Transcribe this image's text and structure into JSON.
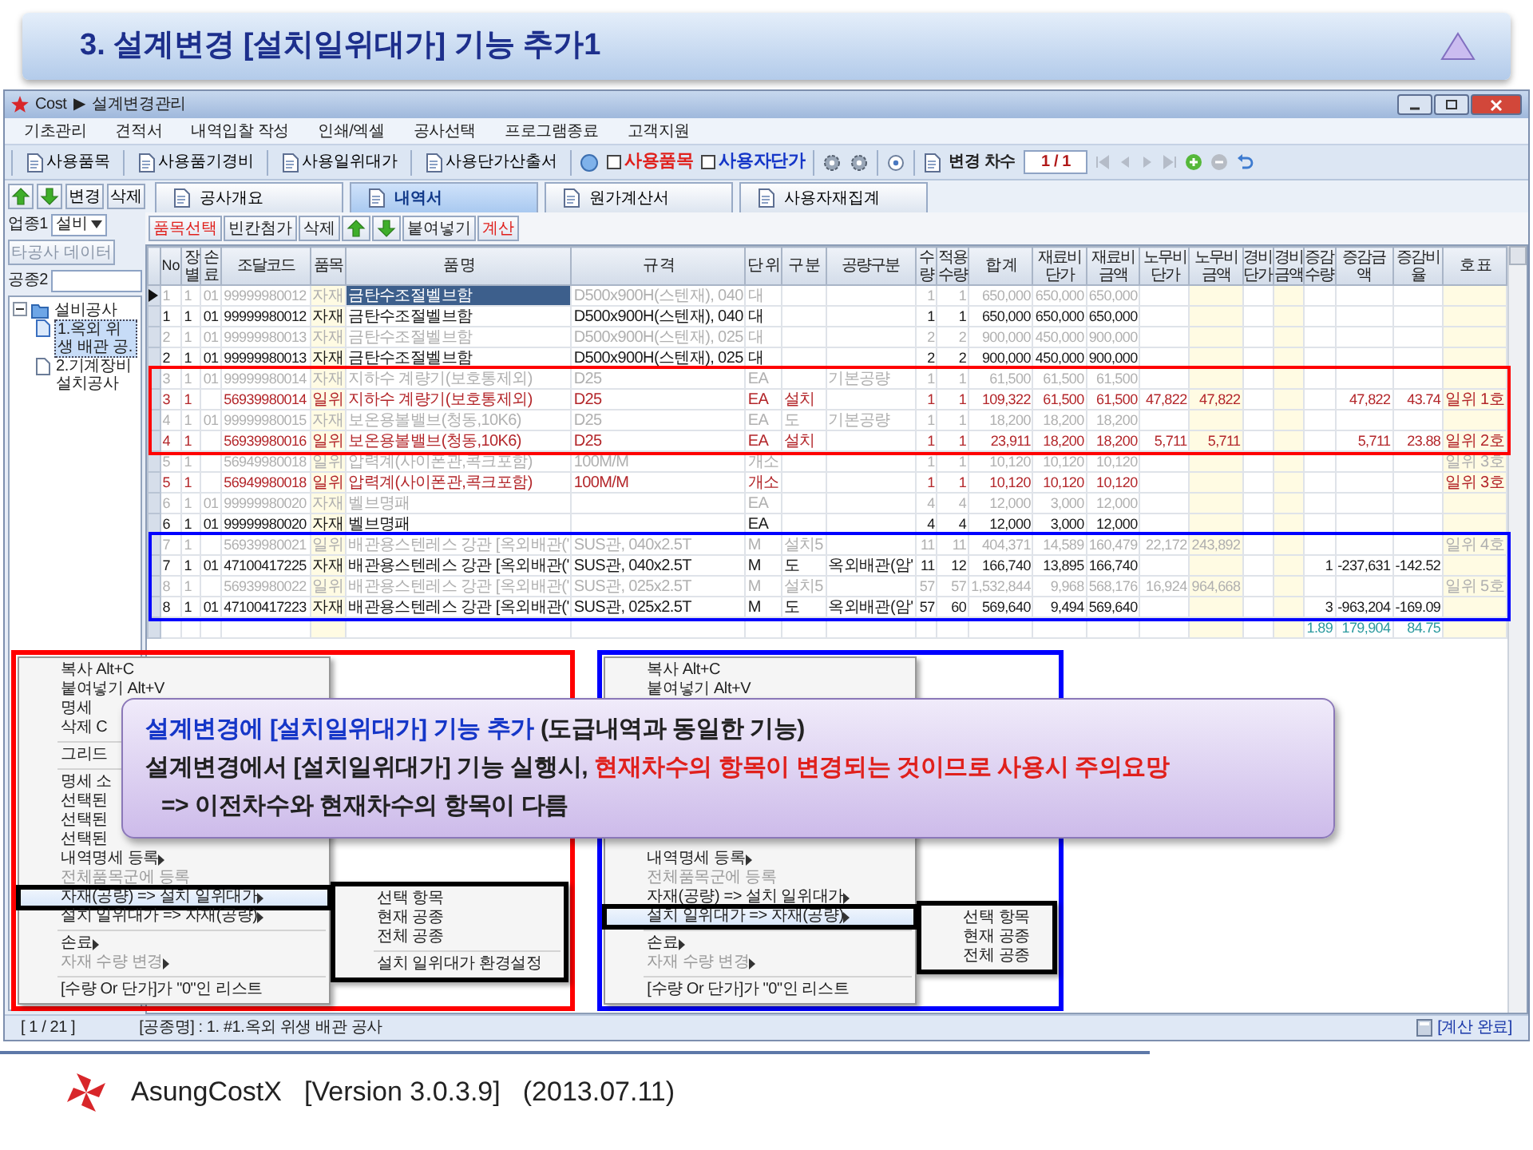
{
  "slide_title": {
    "text": "3. 설계변경 [설치일위대가] 기능 추가1"
  },
  "app": {
    "title_bar": {
      "app_name": "Cost",
      "separator": "▶",
      "screen": "설계변경관리"
    },
    "menu_bar": [
      "기초관리",
      "견적서",
      "내역입찰 작성",
      "인쇄/엑셀",
      "공사선택",
      "프로그램종료",
      "고객지원"
    ],
    "toolbar": {
      "buttons": [
        "사용품목",
        "사용품기경비",
        "사용일위대가",
        "사용단가산출서"
      ],
      "checks": [
        {
          "label": "사용품목",
          "checked": false,
          "color": "#e0201c"
        },
        {
          "label": "사용자단가",
          "checked": false,
          "color": "#1536c8"
        }
      ],
      "revision_label": "변경 차수",
      "revision_value": "1 / 1"
    },
    "left_panel": {
      "buttons": [
        {
          "kind": "up"
        },
        {
          "kind": "down"
        },
        {
          "kind": "text",
          "label": "변경"
        },
        {
          "kind": "text",
          "label": "삭제"
        }
      ],
      "field1_label": "업종1",
      "field1_value": "설비",
      "other_data_button": "타공사 데이터",
      "field2_label": "공종2",
      "tree": [
        {
          "label": "설비공사",
          "expanded": true,
          "selected": false,
          "children": [
            {
              "label": "1.옥외 위생 배관 공.",
              "selected": true
            },
            {
              "label": "2.기계장비 설치공사",
              "selected": false
            }
          ]
        }
      ]
    },
    "tabs": [
      {
        "label": "공사개요",
        "selected": false
      },
      {
        "label": "내역서",
        "selected": true
      },
      {
        "label": "원가계산서",
        "selected": false
      },
      {
        "label": "사용자재집계",
        "selected": false
      }
    ],
    "grid_buttons": [
      {
        "kind": "text",
        "label": "품목선택",
        "color": "#e0201c"
      },
      {
        "kind": "text",
        "label": "빈칸첨가",
        "color": "#222222"
      },
      {
        "kind": "text",
        "label": "삭제",
        "color": "#222222"
      },
      {
        "kind": "up"
      },
      {
        "kind": "down"
      },
      {
        "kind": "text",
        "label": "붙여넣기",
        "color": "#222222"
      },
      {
        "kind": "text",
        "label": "계산",
        "color": "#e0201c"
      }
    ],
    "grid": {
      "columns": [
        "No",
        "장별",
        "손료",
        "조달코드",
        "품목",
        "품 명",
        "규 격",
        "단 위",
        "구 분",
        "공량구분",
        "수 량",
        "적용수량",
        "합 계",
        "재료비단가",
        "재료비금액",
        "노무비단가",
        "노무비금액",
        "경비단가",
        "경비금액",
        "증감수량",
        "증감금액",
        "증감비율",
        "호 표"
      ],
      "rows": [
        {
          "kind": "previous",
          "selected": true,
          "cells": [
            "1",
            "1",
            "01",
            "99999980012",
            "자재",
            "금탄수조절벨브함",
            "D500x900H(스텐재), 040",
            "대",
            null,
            null,
            "1",
            "1",
            "650,000",
            "650,000",
            "650,000",
            null,
            null,
            null,
            null,
            null,
            null,
            null,
            null
          ]
        },
        {
          "kind": "current",
          "selected": false,
          "cells": [
            "1",
            "1",
            "01",
            "99999980012",
            "자재",
            "금탄수조절벨브함",
            "D500x900H(스텐재), 040",
            "대",
            null,
            null,
            "1",
            "1",
            "650,000",
            "650,000",
            "650,000",
            null,
            null,
            null,
            null,
            null,
            null,
            null,
            null
          ]
        },
        {
          "kind": "previous",
          "selected": false,
          "cells": [
            "2",
            "1",
            "01",
            "99999980013",
            "자재",
            "금탄수조절벨브함",
            "D500x900H(스텐재), 025",
            "대",
            null,
            null,
            "2",
            "2",
            "900,000",
            "450,000",
            "900,000",
            null,
            null,
            null,
            null,
            null,
            null,
            null,
            null
          ]
        },
        {
          "kind": "current",
          "selected": false,
          "cells": [
            "2",
            "1",
            "01",
            "99999980013",
            "자재",
            "금탄수조절벨브함",
            "D500x900H(스텐재), 025",
            "대",
            null,
            null,
            "2",
            "2",
            "900,000",
            "450,000",
            "900,000",
            null,
            null,
            null,
            null,
            null,
            null,
            null,
            null
          ]
        },
        {
          "kind": "previous",
          "selected": false,
          "color": "#ff0000",
          "cells": [
            "3",
            "1",
            "01",
            "99999980014",
            "자재",
            "지하수 계량기(보호통제외)",
            "D25",
            "EA",
            null,
            "기본공량",
            "1",
            "1",
            "61,500",
            "61,500",
            "61,500",
            null,
            null,
            null,
            null,
            null,
            null,
            null,
            null
          ]
        },
        {
          "kind": "install",
          "selected": false,
          "color": "#ff0000",
          "cells": [
            "3",
            "1",
            null,
            "56939980014",
            "일위",
            "지하수 계량기(보호통제외)",
            "D25",
            "EA",
            "설치",
            null,
            "1",
            "1",
            "109,322",
            "61,500",
            "61,500",
            "47,822",
            "47,822",
            null,
            null,
            null,
            "47,822",
            "43.74",
            "일위 1호"
          ]
        },
        {
          "kind": "previous",
          "selected": false,
          "color": "#ff0000",
          "cells": [
            "4",
            "1",
            "01",
            "99999980015",
            "자재",
            "보온용볼밸브(청동,10K6)",
            "D25",
            "EA",
            "도",
            "기본공량",
            "1",
            "1",
            "18,200",
            "18,200",
            "18,200",
            null,
            null,
            null,
            null,
            null,
            null,
            null,
            null
          ]
        },
        {
          "kind": "install",
          "selected": false,
          "color": "#ff0000",
          "cells": [
            "4",
            "1",
            null,
            "56939980016",
            "일위",
            "보온용볼밸브(청동,10K6)",
            "D25",
            "EA",
            "설치",
            null,
            "1",
            "1",
            "23,911",
            "18,200",
            "18,200",
            "5,711",
            "5,711",
            null,
            null,
            null,
            "5,711",
            "23.88",
            "일위 2호"
          ]
        },
        {
          "kind": "previous",
          "selected": false,
          "cells": [
            "5",
            "1",
            null,
            "56949980018",
            "일위",
            "압력계(사이폰관,콕크포함)",
            "100M/M",
            "개소",
            null,
            null,
            "1",
            "1",
            "10,120",
            "10,120",
            "10,120",
            null,
            null,
            null,
            null,
            null,
            null,
            null,
            "일위 3호"
          ]
        },
        {
          "kind": "install",
          "selected": false,
          "cells": [
            "5",
            "1",
            null,
            "56949980018",
            "일위",
            "압력계(사이폰관,콕크포함)",
            "100M/M",
            "개소",
            null,
            null,
            "1",
            "1",
            "10,120",
            "10,120",
            "10,120",
            null,
            null,
            null,
            null,
            null,
            null,
            null,
            "일위 3호"
          ]
        },
        {
          "kind": "previous",
          "selected": false,
          "cells": [
            "6",
            "1",
            "01",
            "99999980020",
            "자재",
            "벨브명패",
            null,
            "EA",
            null,
            null,
            "4",
            "4",
            "12,000",
            "3,000",
            "12,000",
            null,
            null,
            null,
            null,
            null,
            null,
            null,
            null
          ]
        },
        {
          "kind": "current",
          "selected": false,
          "cells": [
            "6",
            "1",
            "01",
            "99999980020",
            "자재",
            "벨브명패",
            null,
            "EA",
            null,
            null,
            "4",
            "4",
            "12,000",
            "3,000",
            "12,000",
            null,
            null,
            null,
            null,
            null,
            null,
            null,
            null
          ]
        },
        {
          "kind": "previous",
          "selected": false,
          "color": "#0000ff",
          "cells": [
            "7",
            "1",
            null,
            "56939980021",
            "일위",
            "배관용스텐레스 강관 [옥외배관('",
            "SUS관, 040x2.5T",
            "M",
            "설치5",
            null,
            "11",
            "11",
            "404,371",
            "14,589",
            "160,479",
            "22,172",
            "243,892",
            null,
            null,
            null,
            null,
            null,
            "일위 4호"
          ]
        },
        {
          "kind": "current",
          "selected": false,
          "color": "#0000ff",
          "cells": [
            "7",
            "1",
            "01",
            "47100417225",
            "자재",
            "배관용스텐레스 강관 [옥외배관('",
            "SUS관, 040x2.5T",
            "M",
            "도",
            "옥외배관(암'",
            "11",
            "12",
            "166,740",
            "13,895",
            "166,740",
            null,
            null,
            null,
            null,
            "1",
            "-237,631",
            "-142.52",
            null
          ]
        },
        {
          "kind": "previous",
          "selected": false,
          "color": "#0000ff",
          "cells": [
            "8",
            "1",
            null,
            "56939980022",
            "일위",
            "배관용스텐레스 강관 [옥외배관('",
            "SUS관, 025x2.5T",
            "M",
            "설치5",
            null,
            "57",
            "57",
            "1,532,844",
            "9,968",
            "568,176",
            "16,924",
            "964,668",
            null,
            null,
            null,
            null,
            null,
            "일위 5호"
          ]
        },
        {
          "kind": "current",
          "selected": false,
          "color": "#0000ff",
          "cells": [
            "8",
            "1",
            "01",
            "47100417223",
            "자재",
            "배관용스텐레스 강관 [옥외배관('",
            "SUS관, 025x2.5T",
            "M",
            "도",
            "옥외배관(암'",
            "57",
            "60",
            "569,640",
            "9,494",
            "569,640",
            null,
            null,
            null,
            null,
            "3",
            "-963,204",
            "-169.09",
            null
          ]
        },
        {
          "kind": "subtotal",
          "selected": false,
          "cells": [
            null,
            null,
            null,
            null,
            null,
            null,
            null,
            null,
            null,
            null,
            null,
            null,
            null,
            null,
            null,
            null,
            null,
            null,
            null,
            "1.89",
            "179,904",
            "84.75",
            null
          ]
        }
      ]
    },
    "context_menus": [
      {
        "color": "#ff0000",
        "top_items": [
          {
            "kind": "item",
            "label": "복사 Alt+C",
            "submenu": false,
            "disabled": false,
            "selected": false
          },
          {
            "kind": "item",
            "label": "붙여넣기 Alt+V",
            "submenu": false,
            "disabled": false,
            "selected": false
          },
          {
            "kind": "item",
            "label": "명세",
            "submenu": false,
            "disabled": false,
            "selected": false
          },
          {
            "kind": "item",
            "label": "삭제 C",
            "submenu": false,
            "disabled": false,
            "selected": false
          },
          {
            "kind": "separator"
          },
          {
            "kind": "item",
            "label": "그리드",
            "submenu": false,
            "disabled": false,
            "selected": false
          },
          {
            "kind": "separator"
          },
          {
            "kind": "item",
            "label": "명세 소",
            "submenu": false,
            "disabled": false,
            "selected": false
          },
          {
            "kind": "item",
            "label": "선택된",
            "submenu": false,
            "disabled": false,
            "selected": false
          },
          {
            "kind": "item",
            "label": "선택된",
            "submenu": false,
            "disabled": false,
            "selected": false
          },
          {
            "kind": "item",
            "label": "선택된",
            "submenu": false,
            "disabled": false,
            "selected": false
          }
        ],
        "bottom_items": [
          {
            "kind": "item",
            "label": "내역명세 등록",
            "submenu": true,
            "disabled": false,
            "selected": false
          },
          {
            "kind": "item",
            "label": "전체품목군에 등록",
            "submenu": false,
            "disabled": true,
            "selected": false
          },
          {
            "kind": "item",
            "label": "자재(공량) => 설치 일위대가",
            "submenu": true,
            "disabled": false,
            "selected": true
          },
          {
            "kind": "item",
            "label": "설치 일위대가 => 자재(공량)",
            "submenu": true,
            "disabled": false,
            "selected": false
          },
          {
            "kind": "separator"
          },
          {
            "kind": "item",
            "label": "손료",
            "submenu": true,
            "disabled": false,
            "selected": false
          },
          {
            "kind": "item",
            "label": "자재 수량 변경",
            "submenu": true,
            "disabled": true,
            "selected": false
          },
          {
            "kind": "separator"
          },
          {
            "kind": "item",
            "label": "[수량 Or 단가]가 \"0\"인 리스트",
            "submenu": false,
            "disabled": false,
            "selected": false
          }
        ],
        "submenu": [
          {
            "kind": "item",
            "label": "선택 항목"
          },
          {
            "kind": "item",
            "label": "현재 공종"
          },
          {
            "kind": "item",
            "label": "전체 공종"
          },
          {
            "kind": "separator"
          },
          {
            "kind": "item",
            "label": "설치 일위대가 환경설정"
          }
        ]
      },
      {
        "color": "#0000ff",
        "top_items": [
          {
            "kind": "item",
            "label": "복사 Alt+C",
            "submenu": false,
            "disabled": false,
            "selected": false
          },
          {
            "kind": "item",
            "label": "붙여넣기 Alt+V",
            "submenu": false,
            "disabled": false,
            "selected": false
          }
        ],
        "bottom_items": [
          {
            "kind": "item",
            "label": "내역명세 등록",
            "submenu": true,
            "disabled": false,
            "selected": false
          },
          {
            "kind": "item",
            "label": "전체품목군에 등록",
            "submenu": false,
            "disabled": true,
            "selected": false
          },
          {
            "kind": "item",
            "label": "자재(공량) => 설치 일위대가",
            "submenu": true,
            "disabled": false,
            "selected": false
          },
          {
            "kind": "item",
            "label": "설치 일위대가 => 자재(공량)",
            "submenu": true,
            "disabled": false,
            "selected": true
          },
          {
            "kind": "separator"
          },
          {
            "kind": "item",
            "label": "손료",
            "submenu": true,
            "disabled": false,
            "selected": false
          },
          {
            "kind": "item",
            "label": "자재 수량 변경",
            "submenu": true,
            "disabled": true,
            "selected": false
          },
          {
            "kind": "separator"
          },
          {
            "kind": "item",
            "label": "[수량 Or 단가]가 \"0\"인 리스트",
            "submenu": false,
            "disabled": false,
            "selected": false
          }
        ],
        "submenu": [
          {
            "kind": "item",
            "label": "선택 항목"
          },
          {
            "kind": "item",
            "label": "현재 공종"
          },
          {
            "kind": "item",
            "label": "전체 공종"
          }
        ]
      }
    ],
    "status_bar": {
      "page": "[ 1 / 21 ]",
      "work_name": "[공종명] : 1. #1.옥외 위생 배관 공사",
      "calc_status": "[계산 완료]"
    }
  },
  "callout": {
    "lines": [
      [
        {
          "text": "설계변경에 [설치일위대가] 기능 추가",
          "color": "#1536c8"
        },
        {
          "text": "(도급내역과 동일한 기능)",
          "color": "#222222"
        }
      ],
      [
        {
          "text": "설계변경에서 [설치일위대가] 기능 실행시,",
          "color": "#222222"
        },
        {
          "text": "현재차수의 항목이 변경되는 것이므로 사용시 주의요망",
          "color": "#e0201c"
        }
      ],
      [
        {
          "text": "=> 이전차수와 현재차수의 항목이 다름",
          "color": "#222222"
        }
      ]
    ]
  },
  "footer": {
    "product": "AsungCostX",
    "version": "[Version 3.0.3.9]",
    "date": "(2013.07.11)"
  }
}
